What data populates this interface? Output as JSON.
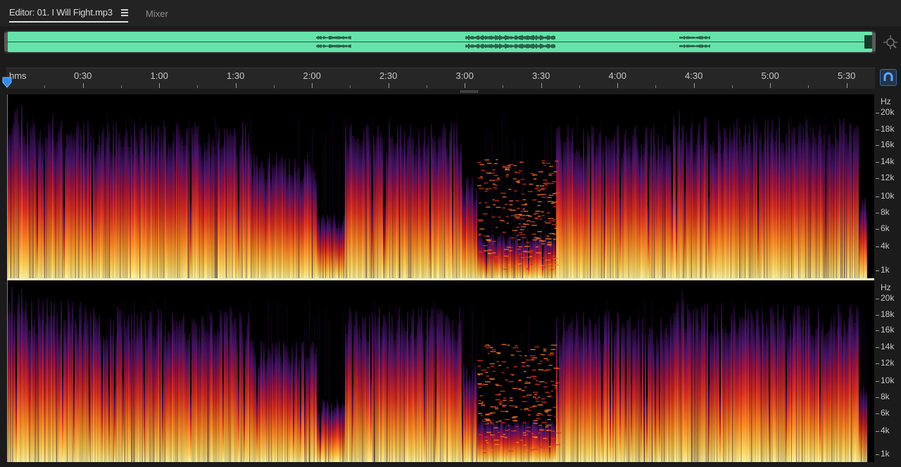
{
  "tabs": {
    "editor_label": "Editor: 01. I Will Fight.mp3",
    "mixer_label": "Mixer"
  },
  "timeline": {
    "unit_label": "hms",
    "total_seconds": 340,
    "ticks": [
      "0:30",
      "1:00",
      "1:30",
      "2:00",
      "2:30",
      "3:00",
      "3:30",
      "4:00",
      "4:30",
      "5:00",
      "5:30"
    ]
  },
  "frequency_scale": {
    "unit": "Hz",
    "labels": [
      "20k",
      "18k",
      "16k",
      "14k",
      "12k",
      "10k",
      "8k",
      "6k",
      "4k",
      "1k"
    ]
  },
  "colors": {
    "overview_wave": "#66e3aa",
    "spectrogram_high": "#ffe07a",
    "spectrogram_mid": "#d81e2a",
    "spectrogram_low": "#4a1670"
  },
  "icons": {
    "zoom": "zoom-icon",
    "tab_menu": "menu-icon",
    "snap": "magnet-icon",
    "playhead": "playhead-icon"
  }
}
